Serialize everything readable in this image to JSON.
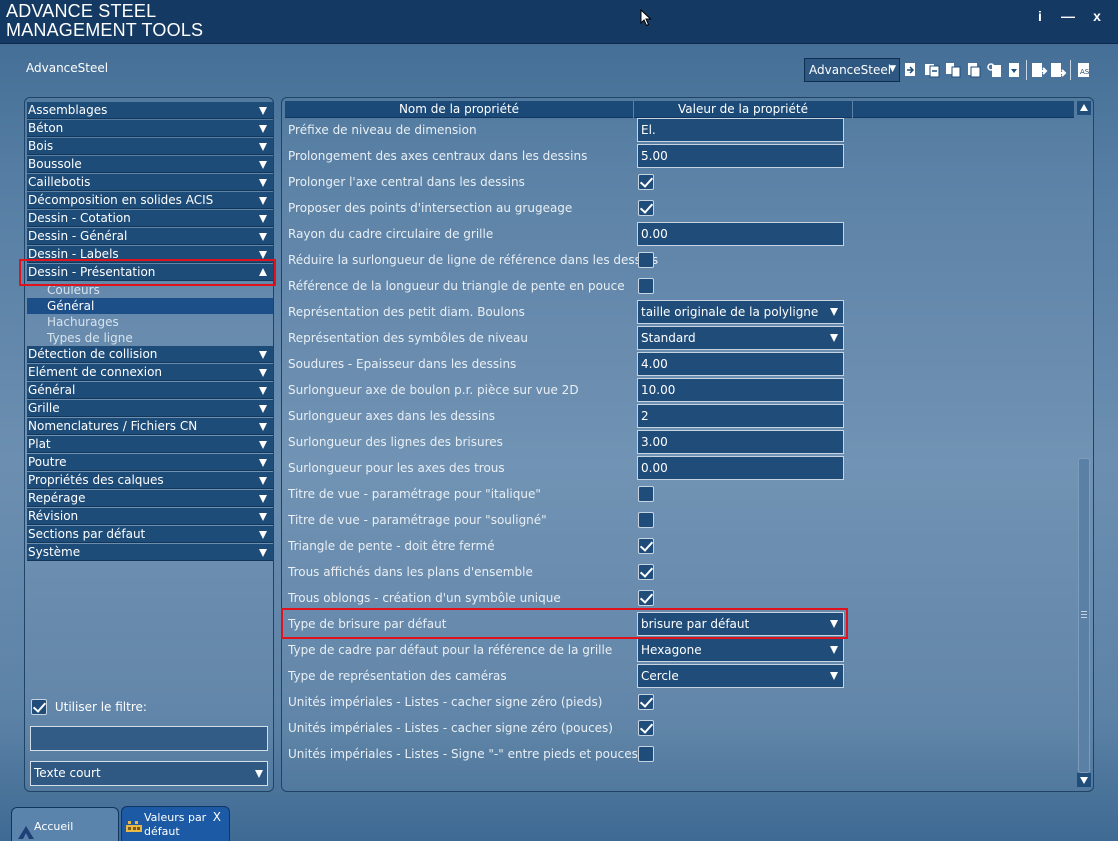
{
  "app": {
    "title_line1": "ADVANCE STEEL",
    "title_line2": "MANAGEMENT TOOLS",
    "window_buttons": {
      "info": "i",
      "minimize": "—",
      "close": "x"
    }
  },
  "workspace_label": "AdvanceSteel",
  "toolbar": {
    "database_select": "AdvanceSteel",
    "icons": [
      "import-defaults-icon",
      "import-all-icon",
      "compare-icon",
      "copy-icon",
      "search-icon",
      "export-icon",
      "export-changed-icon",
      "export-all-icon",
      "advance-steel-icon"
    ]
  },
  "categories": [
    {
      "label": "Assemblages",
      "expanded": false
    },
    {
      "label": "Béton",
      "expanded": false
    },
    {
      "label": "Bois",
      "expanded": false
    },
    {
      "label": "Boussole",
      "expanded": false
    },
    {
      "label": "Caillebotis",
      "expanded": false
    },
    {
      "label": "Décomposition en solides ACIS",
      "expanded": false
    },
    {
      "label": "Dessin - Cotation",
      "expanded": false
    },
    {
      "label": "Dessin - Général",
      "expanded": false
    },
    {
      "label": "Dessin - Labels",
      "expanded": false
    },
    {
      "label": "Dessin - Présentation",
      "expanded": true
    },
    {
      "label": "Détection de collision",
      "expanded": false
    },
    {
      "label": "Elément de connexion",
      "expanded": false
    },
    {
      "label": "Général",
      "expanded": false
    },
    {
      "label": "Grille",
      "expanded": false
    },
    {
      "label": "Nomenclatures / Fichiers CN",
      "expanded": false
    },
    {
      "label": "Plat",
      "expanded": false
    },
    {
      "label": "Poutre",
      "expanded": false
    },
    {
      "label": "Propriétés des calques",
      "expanded": false
    },
    {
      "label": "Repérage",
      "expanded": false
    },
    {
      "label": "Révision",
      "expanded": false
    },
    {
      "label": "Sections par défaut",
      "expanded": false
    },
    {
      "label": "Système",
      "expanded": false
    }
  ],
  "subcategories": [
    {
      "label": "Couleurs",
      "selected": false
    },
    {
      "label": "Général",
      "selected": true
    },
    {
      "label": "Hachurages",
      "selected": false
    },
    {
      "label": "Types de ligne",
      "selected": false
    }
  ],
  "filter": {
    "checkbox_label": "Utiliser le filtre:",
    "checked": true,
    "text_value": "",
    "mode_select": "Texte court"
  },
  "grid": {
    "col_name": "Nom de la propriété",
    "col_value": "Valeur de la propriété",
    "rows": [
      {
        "name": "Préfixe de niveau de dimension",
        "type": "text",
        "value": "El."
      },
      {
        "name": "Prolongement des axes centraux dans les dessins",
        "type": "text",
        "value": "5.00"
      },
      {
        "name": "Prolonger l'axe central dans les dessins",
        "type": "check",
        "checked": true
      },
      {
        "name": "Proposer des points d'intersection au grugeage",
        "type": "check",
        "checked": true
      },
      {
        "name": "Rayon du cadre circulaire de grille",
        "type": "text",
        "value": "0.00"
      },
      {
        "name": "Réduire la surlongueur de ligne de référence dans les dessins",
        "type": "check",
        "checked": false
      },
      {
        "name": "Référence de la longueur du triangle de pente en pouce",
        "type": "check",
        "checked": false
      },
      {
        "name": "Représentation des petit diam. Boulons",
        "type": "combo",
        "value": "taille originale de la polyligne"
      },
      {
        "name": "Représentation des symbôles de niveau",
        "type": "combo",
        "value": "Standard"
      },
      {
        "name": "Soudures - Epaisseur dans les dessins",
        "type": "text",
        "value": "4.00"
      },
      {
        "name": "Surlongueur axe de boulon p.r. pièce sur vue 2D",
        "type": "text",
        "value": "10.00"
      },
      {
        "name": "Surlongueur axes dans les dessins",
        "type": "text",
        "value": "2"
      },
      {
        "name": "Surlongueur des lignes des brisures",
        "type": "text",
        "value": "3.00"
      },
      {
        "name": "Surlongueur pour les axes des trous",
        "type": "text",
        "value": "0.00"
      },
      {
        "name": "Titre de vue - paramétrage pour \"italique\"",
        "type": "check",
        "checked": false
      },
      {
        "name": "Titre de vue - paramétrage pour \"souligné\"",
        "type": "check",
        "checked": false
      },
      {
        "name": "Triangle de pente - doit être fermé",
        "type": "check",
        "checked": true
      },
      {
        "name": "Trous affichés dans les plans d'ensemble",
        "type": "check",
        "checked": true
      },
      {
        "name": "Trous oblongs - création d'un symbôle unique",
        "type": "check",
        "checked": true
      },
      {
        "name": "Type de brisure par défaut",
        "type": "combo",
        "value": "brisure par défaut",
        "highlighted": true
      },
      {
        "name": "Type de cadre par défaut pour la référence de la grille",
        "type": "combo",
        "value": "Hexagone"
      },
      {
        "name": "Type de représentation des caméras",
        "type": "combo",
        "value": "Cercle"
      },
      {
        "name": "Unités impériales - Listes - cacher signe zéro (pieds)",
        "type": "check",
        "checked": true
      },
      {
        "name": "Unités impériales - Listes - cacher signe zéro (pouces)",
        "type": "check",
        "checked": true
      },
      {
        "name": "Unités impériales - Listes - Signe \"-\" entre pieds et pouces",
        "type": "check",
        "checked": false
      }
    ]
  },
  "tabs": {
    "home": "Accueil",
    "values_line1": "Valeurs par",
    "values_line2": "défaut",
    "close": "X"
  },
  "colors": {
    "title_bar": "#143a63",
    "accent": "#1e4c79",
    "highlight_border": "#e0121b",
    "selected": "#1c4f88"
  }
}
